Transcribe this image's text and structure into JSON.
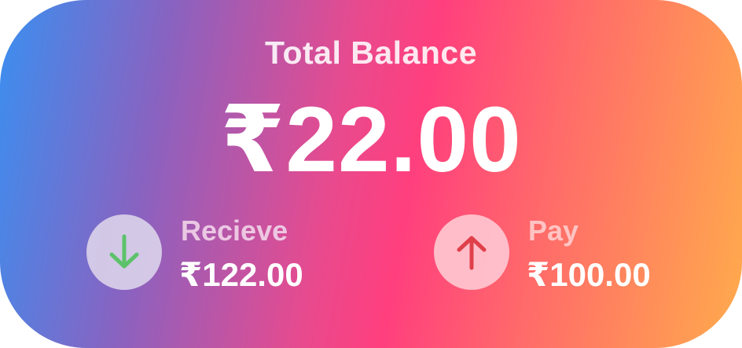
{
  "balance": {
    "title": "Total Balance",
    "amount": "₹22.00"
  },
  "receive": {
    "label": "Recieve",
    "amount": "₹122.00",
    "icon": "arrow-down-icon",
    "icon_color": "#5cc26a"
  },
  "pay": {
    "label": "Pay",
    "amount": "₹100.00",
    "icon": "arrow-up-icon",
    "icon_color": "#e0404a"
  }
}
